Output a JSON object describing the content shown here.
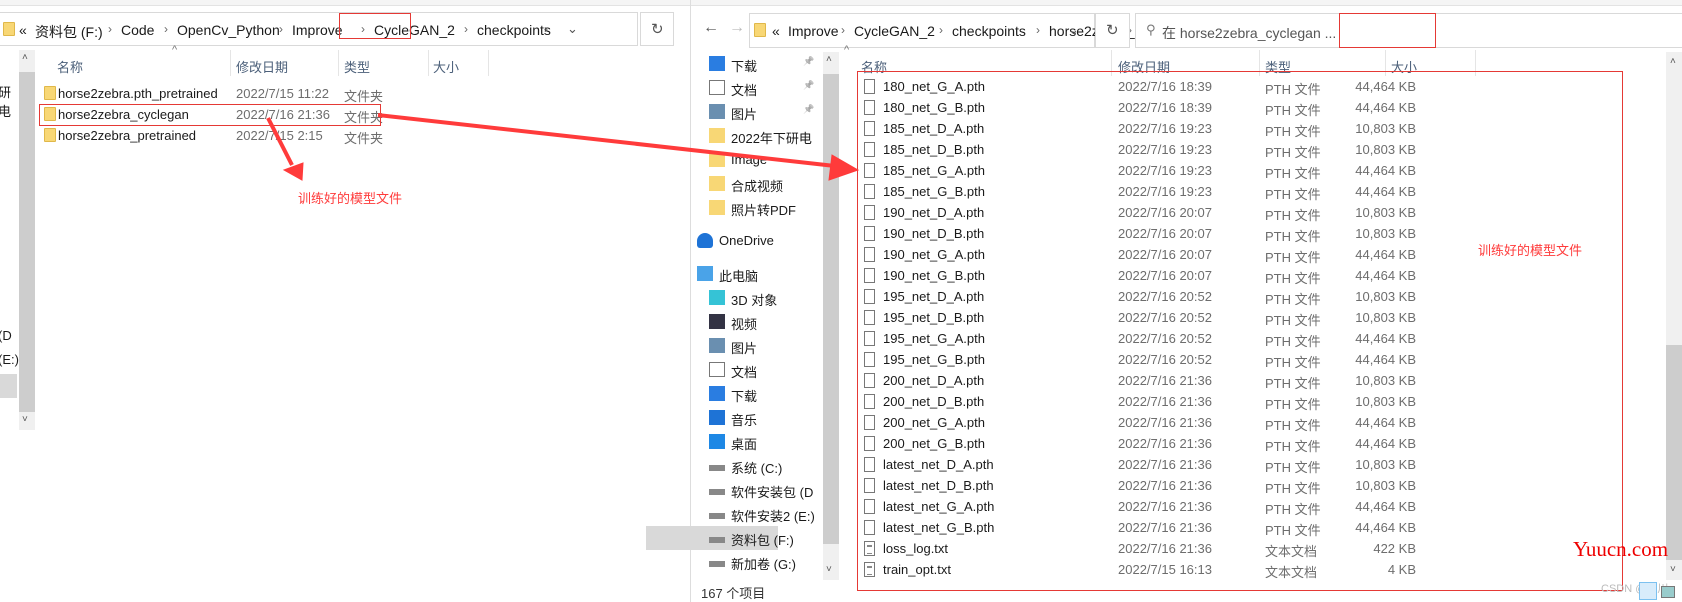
{
  "left_window": {
    "breadcrumb": [
      "«",
      "资料包 (F:)",
      "Code",
      "OpenCv_Python",
      "Improve",
      "CycleGAN_2",
      "checkpoints"
    ],
    "columns": [
      "名称",
      "修改日期",
      "类型",
      "大小"
    ],
    "nav_fragments": [
      "研电",
      "(D",
      "(E:)"
    ],
    "rows": [
      {
        "name": "horse2zebra.pth_pretrained",
        "date": "2022/7/15 11:22",
        "type": "文件夹"
      },
      {
        "name": "horse2zebra_cyclegan",
        "date": "2022/7/16 21:36",
        "type": "文件夹"
      },
      {
        "name": "horse2zebra_pretrained",
        "date": "2022/7/15 2:15",
        "type": "文件夹"
      }
    ],
    "annotation": "训练好的模型文件"
  },
  "right_window": {
    "breadcrumb": [
      "«",
      "Improve",
      "CycleGAN_2",
      "checkpoints",
      "horse2zebra_cyclegan"
    ],
    "search_placeholder": "在 horse2zebra_cyclegan ...",
    "columns": [
      "名称",
      "修改日期",
      "类型",
      "大小"
    ],
    "nav": [
      {
        "label": "下载",
        "icon": "download-icon",
        "pinned": true
      },
      {
        "label": "文档",
        "icon": "document-icon",
        "pinned": true
      },
      {
        "label": "图片",
        "icon": "picture-icon",
        "pinned": true
      },
      {
        "label": "2022年下研电",
        "icon": "folder-icon"
      },
      {
        "label": "Image",
        "icon": "folder-icon"
      },
      {
        "label": "合成视频",
        "icon": "folder-icon"
      },
      {
        "label": "照片转PDF",
        "icon": "folder-icon"
      },
      {
        "label": "OneDrive",
        "icon": "cloud-icon",
        "top": true
      },
      {
        "label": "此电脑",
        "icon": "computer-icon",
        "top": true
      },
      {
        "label": "3D 对象",
        "icon": "cube-icon"
      },
      {
        "label": "视频",
        "icon": "video-icon"
      },
      {
        "label": "图片",
        "icon": "picture-icon"
      },
      {
        "label": "文档",
        "icon": "document-icon"
      },
      {
        "label": "下载",
        "icon": "download-icon"
      },
      {
        "label": "音乐",
        "icon": "music-icon"
      },
      {
        "label": "桌面",
        "icon": "desktop-icon"
      },
      {
        "label": "系统 (C:)",
        "icon": "drive-icon"
      },
      {
        "label": "软件安装包 (D",
        "icon": "drive-icon"
      },
      {
        "label": "软件安装2 (E:)",
        "icon": "drive-icon"
      },
      {
        "label": "资料包 (F:)",
        "icon": "drive-icon",
        "selected": true
      },
      {
        "label": "新加卷 (G:)",
        "icon": "drive-icon"
      }
    ],
    "rows": [
      {
        "name": "180_net_G_A.pth",
        "date": "2022/7/16 18:39",
        "type": "PTH 文件",
        "size": "44,464 KB"
      },
      {
        "name": "180_net_G_B.pth",
        "date": "2022/7/16 18:39",
        "type": "PTH 文件",
        "size": "44,464 KB"
      },
      {
        "name": "185_net_D_A.pth",
        "date": "2022/7/16 19:23",
        "type": "PTH 文件",
        "size": "10,803 KB"
      },
      {
        "name": "185_net_D_B.pth",
        "date": "2022/7/16 19:23",
        "type": "PTH 文件",
        "size": "10,803 KB"
      },
      {
        "name": "185_net_G_A.pth",
        "date": "2022/7/16 19:23",
        "type": "PTH 文件",
        "size": "44,464 KB"
      },
      {
        "name": "185_net_G_B.pth",
        "date": "2022/7/16 19:23",
        "type": "PTH 文件",
        "size": "44,464 KB"
      },
      {
        "name": "190_net_D_A.pth",
        "date": "2022/7/16 20:07",
        "type": "PTH 文件",
        "size": "10,803 KB"
      },
      {
        "name": "190_net_D_B.pth",
        "date": "2022/7/16 20:07",
        "type": "PTH 文件",
        "size": "10,803 KB"
      },
      {
        "name": "190_net_G_A.pth",
        "date": "2022/7/16 20:07",
        "type": "PTH 文件",
        "size": "44,464 KB"
      },
      {
        "name": "190_net_G_B.pth",
        "date": "2022/7/16 20:07",
        "type": "PTH 文件",
        "size": "44,464 KB"
      },
      {
        "name": "195_net_D_A.pth",
        "date": "2022/7/16 20:52",
        "type": "PTH 文件",
        "size": "10,803 KB"
      },
      {
        "name": "195_net_D_B.pth",
        "date": "2022/7/16 20:52",
        "type": "PTH 文件",
        "size": "10,803 KB"
      },
      {
        "name": "195_net_G_A.pth",
        "date": "2022/7/16 20:52",
        "type": "PTH 文件",
        "size": "44,464 KB"
      },
      {
        "name": "195_net_G_B.pth",
        "date": "2022/7/16 20:52",
        "type": "PTH 文件",
        "size": "44,464 KB"
      },
      {
        "name": "200_net_D_A.pth",
        "date": "2022/7/16 21:36",
        "type": "PTH 文件",
        "size": "10,803 KB"
      },
      {
        "name": "200_net_D_B.pth",
        "date": "2022/7/16 21:36",
        "type": "PTH 文件",
        "size": "10,803 KB"
      },
      {
        "name": "200_net_G_A.pth",
        "date": "2022/7/16 21:36",
        "type": "PTH 文件",
        "size": "44,464 KB"
      },
      {
        "name": "200_net_G_B.pth",
        "date": "2022/7/16 21:36",
        "type": "PTH 文件",
        "size": "44,464 KB"
      },
      {
        "name": "latest_net_D_A.pth",
        "date": "2022/7/16 21:36",
        "type": "PTH 文件",
        "size": "10,803 KB"
      },
      {
        "name": "latest_net_D_B.pth",
        "date": "2022/7/16 21:36",
        "type": "PTH 文件",
        "size": "10,803 KB"
      },
      {
        "name": "latest_net_G_A.pth",
        "date": "2022/7/16 21:36",
        "type": "PTH 文件",
        "size": "44,464 KB"
      },
      {
        "name": "latest_net_G_B.pth",
        "date": "2022/7/16 21:36",
        "type": "PTH 文件",
        "size": "44,464 KB"
      },
      {
        "name": "loss_log.txt",
        "date": "2022/7/16 21:36",
        "type": "文本文档",
        "size": "422 KB",
        "txt": true
      },
      {
        "name": "train_opt.txt",
        "date": "2022/7/15 16:13",
        "type": "文本文档",
        "size": "4 KB",
        "txt": true
      }
    ],
    "status": "167 个项目",
    "annotation": "训练好的模型文件"
  },
  "watermark": "Yuucn.com",
  "credit": "CSDN @佐川",
  "colors": {
    "annotation": "#ff3b3b",
    "highlight_box": "#e53935",
    "selected_nav": "#d9d9d9",
    "header_text": "#4c607a"
  }
}
